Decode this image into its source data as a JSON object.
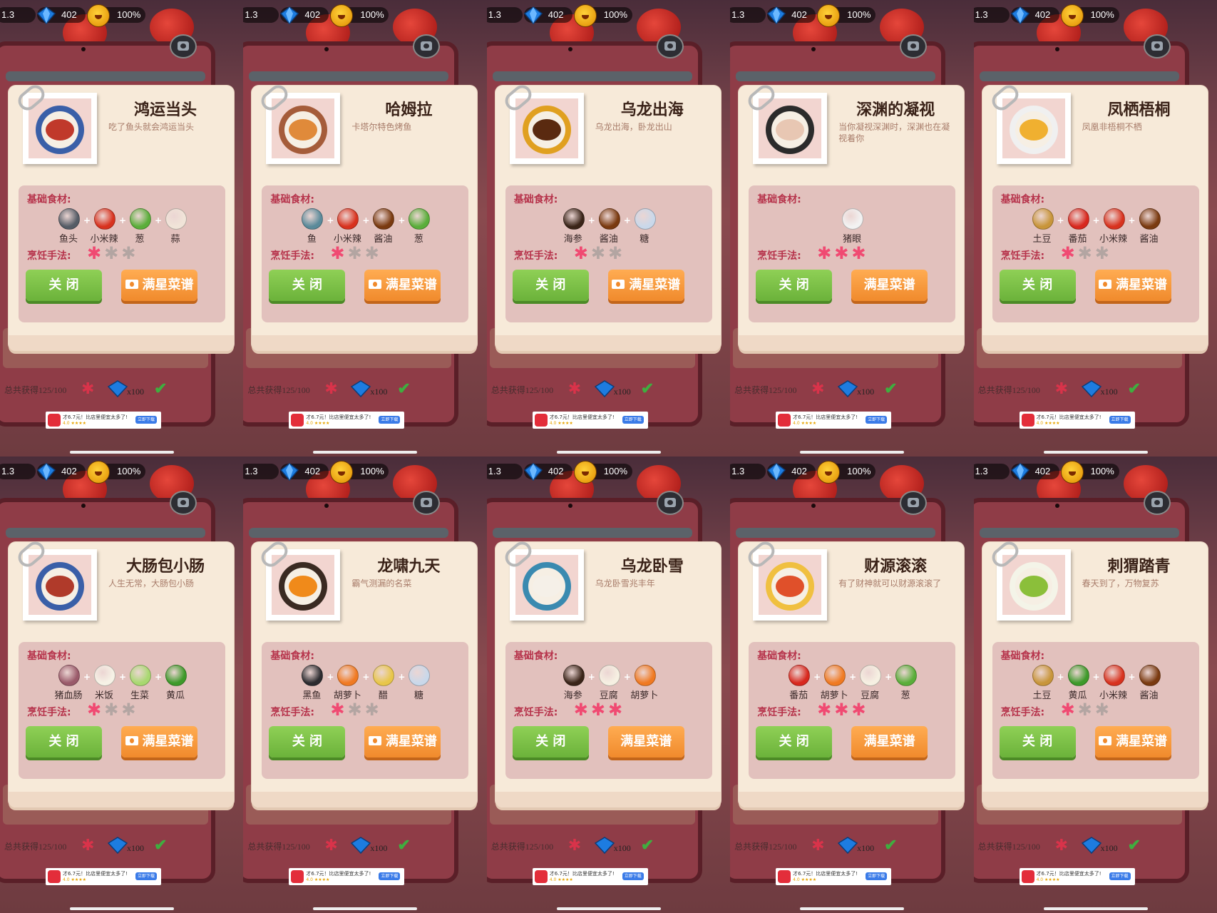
{
  "hud": {
    "level": "1.3",
    "gems": "402",
    "mood": "100%"
  },
  "labels": {
    "ingredients": "基础食材:",
    "method": "烹饪手法:",
    "close": "关 闭",
    "full_recipe": "满星菜谱",
    "total": "总共获得125/100",
    "reward": "x100",
    "ad_text": "才6.7元！比店里便宜太多了!",
    "ad_rating": "4.0 ★★★★",
    "ad_button": "立即下载"
  },
  "colors": {
    "star_on": "#f04a72",
    "star_off": "#b3a5a2",
    "close_btn": "#6bb23a",
    "full_btn": "#f08a2c",
    "title": "#3a2218",
    "label": "#b6324a"
  },
  "dishes": [
    {
      "name": "鸿运当头",
      "desc": "吃了鱼头就会鸿运当头",
      "ingredients": [
        "鱼头",
        "小米辣",
        "葱",
        "蒜"
      ],
      "icons": [
        "fishhead-icon",
        "chili-icon",
        "scallion-icon",
        "garlic-icon"
      ],
      "stars": 1,
      "video": true,
      "plate": "#3a5fa8",
      "food": "#c0392b"
    },
    {
      "name": "哈姆拉",
      "desc": "卡塔尔特色烤鱼",
      "ingredients": [
        "鱼",
        "小米辣",
        "酱油",
        "葱"
      ],
      "icons": [
        "fish-icon",
        "chili-icon",
        "soysauce-icon",
        "scallion-icon"
      ],
      "stars": 1,
      "video": true,
      "plate": "#a55c3a",
      "food": "#e08a3a"
    },
    {
      "name": "乌龙出海",
      "desc": "乌龙出海，卧龙出山",
      "ingredients": [
        "海参",
        "酱油",
        "糖"
      ],
      "icons": [
        "seacucumber-icon",
        "soysauce-icon",
        "sugar-icon"
      ],
      "stars": 1,
      "video": true,
      "plate": "#e0a020",
      "food": "#5a2a10"
    },
    {
      "name": "深渊的凝视",
      "desc": "当你凝视深渊时，深渊也在凝视着你",
      "ingredients": [
        "猪眼"
      ],
      "icons": [
        "eyeball-icon"
      ],
      "stars": 3,
      "video": false,
      "plate": "#2b2b2b",
      "food": "#e8c7b3"
    },
    {
      "name": "凤栖梧桐",
      "desc": "凤凰非梧桐不栖",
      "ingredients": [
        "土豆",
        "番茄",
        "小米辣",
        "酱油"
      ],
      "icons": [
        "potato-icon",
        "tomato-icon",
        "chili-icon",
        "soysauce-icon"
      ],
      "stars": 1,
      "video": true,
      "plate": "#f0f0f0",
      "food": "#f0b030"
    },
    {
      "name": "大肠包小肠",
      "desc": "人生无常，大肠包小肠",
      "ingredients": [
        "猪血肠",
        "米饭",
        "生菜",
        "黄瓜"
      ],
      "icons": [
        "sausage-icon",
        "rice-icon",
        "lettuce-icon",
        "cucumber-icon"
      ],
      "stars": 1,
      "video": true,
      "plate": "#3a5fa8",
      "food": "#b03a2a"
    },
    {
      "name": "龙啸九天",
      "desc": "霸气测漏的名菜",
      "ingredients": [
        "黑鱼",
        "胡萝卜",
        "醋",
        "糖"
      ],
      "icons": [
        "blackfish-icon",
        "carrot-icon",
        "vinegar-icon",
        "sugar-icon"
      ],
      "stars": 1,
      "video": true,
      "plate": "#3a2a22",
      "food": "#f08a1a"
    },
    {
      "name": "乌龙卧雪",
      "desc": "乌龙卧雪兆丰年",
      "ingredients": [
        "海参",
        "豆腐",
        "胡萝卜"
      ],
      "icons": [
        "seacucumber-icon",
        "tofu-icon",
        "carrot-icon"
      ],
      "stars": 3,
      "video": false,
      "plate": "#3a8ab0",
      "food": "#f5f0e8"
    },
    {
      "name": "财源滚滚",
      "desc": "有了财神就可以财源滚滚了",
      "ingredients": [
        "番茄",
        "胡萝卜",
        "豆腐",
        "葱"
      ],
      "icons": [
        "tomato-icon",
        "carrot-icon",
        "tofu-icon",
        "scallion-icon"
      ],
      "stars": 3,
      "video": false,
      "plate": "#f0c040",
      "food": "#e0502a"
    },
    {
      "name": "刺猬踏青",
      "desc": "春天到了，万物复苏",
      "ingredients": [
        "土豆",
        "黄瓜",
        "小米辣",
        "酱油"
      ],
      "icons": [
        "potato-icon",
        "cucumber-icon",
        "chili-icon",
        "soysauce-icon"
      ],
      "stars": 1,
      "video": true,
      "plate": "#f4f4e8",
      "food": "#8bbf3a"
    }
  ]
}
